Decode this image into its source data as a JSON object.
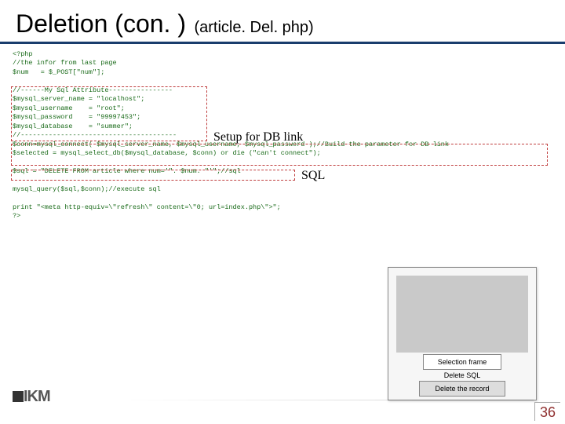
{
  "title": {
    "main": "Deletion (con. )",
    "sub": "(article. Del. php)"
  },
  "code": {
    "l01": "<?php",
    "l02": "//the infor from last page",
    "l03": "$num   = $_POST[\"num\"];",
    "l04": "",
    "l05": "//------My Sql Attribute----------------",
    "l06": "$mysql_server_name = \"localhost\";",
    "l07": "$mysql_username    = \"root\";",
    "l08": "$mysql_password    = \"99997453\";",
    "l09": "$mysql_database    = \"summer\";",
    "l10": "//---------------------------------------",
    "l11": "$conn=mysql_connect( $mysql_server_name, $mysql_username, $mysql_password );//Build the parameter for DB link",
    "l12": "$selected = mysql_select_db($mysql_database, $conn) or die (\"can't connect\");",
    "l13": "",
    "l14": "$sql = \"DELETE FROM article where num='\". $num. \"'\";//sql",
    "l15": "",
    "l16": "mysql_query($sql,$conn);//execute sql",
    "l17": "",
    "l18": "print \"<meta http-equiv=\\\"refresh\\\" content=\\\"0; url=index.php\\\">\";",
    "l19": "?>"
  },
  "annot": {
    "setup": "Setup for DB link",
    "sql": "SQL"
  },
  "thumb": {
    "b1": "Selection frame",
    "b2": "Delete SQL",
    "b3": "Delete the record"
  },
  "logo": "IKM",
  "page": "36"
}
